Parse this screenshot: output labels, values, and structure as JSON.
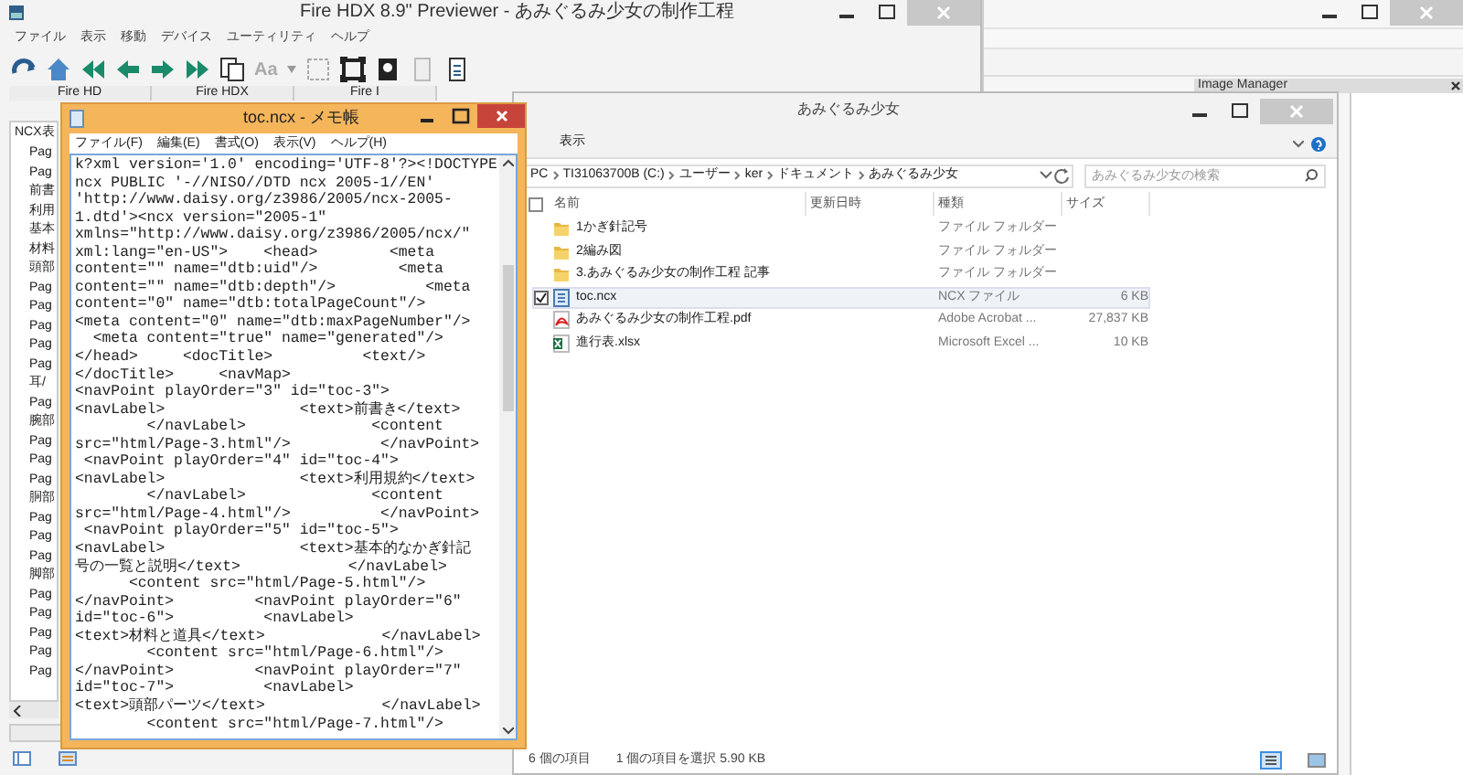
{
  "previewer": {
    "title": "Fire HDX 8.9\" Previewer - あみぐるみ少女の制作工程",
    "menu": [
      "ファイル",
      "表示",
      "移動",
      "デバイス",
      "ユーティリティ",
      "ヘルプ"
    ],
    "font_button": "Aa",
    "tabs": [
      {
        "label": "Fire HD",
        "selected": false
      },
      {
        "label": "Fire HDX",
        "selected": false
      },
      {
        "label": "Fire I",
        "selected": false
      }
    ],
    "panel_title": "NCX表",
    "ncx_items": [
      "Pag",
      "Pag",
      "前書",
      "利用",
      "基本",
      "材料",
      "頭部",
      "Pag",
      "Pag",
      "Pag",
      "Pag",
      "Pag",
      "耳/",
      "Pag",
      "腕部",
      "Pag",
      "Pag",
      "Pag",
      "胴部",
      "Pag",
      "Pag",
      "Pag",
      "脚部",
      "Pag",
      "Pag",
      "Pag",
      "Pag",
      "Pag"
    ]
  },
  "image_manager": {
    "title": "Image Manager"
  },
  "notepad": {
    "title": "toc.ncx - メモ帳",
    "menu": [
      "ファイル(F)",
      "編集(E)",
      "書式(O)",
      "表示(V)",
      "ヘルプ(H)"
    ],
    "lines": [
      "k?xml version='1.0' encoding='UTF-8'?><!DOCTYPE",
      "ncx PUBLIC '-//NISO//DTD ncx 2005-1//EN'",
      "'http://www.daisy.org/z3986/2005/ncx-2005-",
      "1.dtd'><ncx version=\"2005-1\"",
      "xmlns=\"http://www.daisy.org/z3986/2005/ncx/\"",
      "xml:lang=\"en-US\">    <head>        <meta",
      "content=\"\" name=\"dtb:uid\"/>         <meta",
      "content=\"\" name=\"dtb:depth\"/>          <meta",
      "content=\"0\" name=\"dtb:totalPageCount\"/>",
      "<meta content=\"0\" name=\"dtb:maxPageNumber\"/>",
      "  <meta content=\"true\" name=\"generated\"/>",
      "</head>     <docTitle>          <text/>",
      "</docTitle>     <navMap>",
      "<navPoint playOrder=\"3\" id=\"toc-3\">",
      "<navLabel>               <text>前書き</text>",
      "        </navLabel>              <content",
      "src=\"html/Page-3.html\"/>          </navPoint>",
      " <navPoint playOrder=\"4\" id=\"toc-4\">",
      "<navLabel>               <text>利用規約</text>",
      "        </navLabel>              <content",
      "src=\"html/Page-4.html\"/>          </navPoint>",
      " <navPoint playOrder=\"5\" id=\"toc-5\">",
      "<navLabel>               <text>基本的なかぎ針記",
      "号の一覧と説明</text>            </navLabel>",
      "      <content src=\"html/Page-5.html\"/>",
      "</navPoint>         <navPoint playOrder=\"6\"",
      "id=\"toc-6\">          <navLabel>",
      "<text>材料と道具</text>             </navLabel>",
      "        <content src=\"html/Page-6.html\"/>",
      "</navPoint>         <navPoint playOrder=\"7\"",
      "id=\"toc-7\">          <navLabel>",
      "<text>頭部パーツ</text>             </navLabel>",
      "        <content src=\"html/Page-7.html\"/>"
    ]
  },
  "explorer": {
    "title": "あみぐるみ少女",
    "ribbon_tab": "表示",
    "path": [
      "PC",
      "TI31063700B (C:)",
      "ユーザー",
      "ker",
      "ドキュメント",
      "あみぐるみ少女"
    ],
    "search": {
      "placeholder": "あみぐるみ少女の検索"
    },
    "columns": [
      "名前",
      "更新日時",
      "種類",
      "サイズ"
    ],
    "select_all": {
      "checked": false
    },
    "files": [
      {
        "kind": "folder",
        "name": "1かぎ針記号",
        "type": "ファイル フォルダー",
        "selected": false
      },
      {
        "kind": "folder",
        "name": "2編み図",
        "type": "ファイル フォルダー",
        "selected": false
      },
      {
        "kind": "folder",
        "name": "3.あみぐるみ少女の制作工程  記事",
        "type": "ファイル フォルダー",
        "selected": false
      },
      {
        "kind": "ncx",
        "name": "toc.ncx",
        "type": "NCX ファイル",
        "size": "6 KB",
        "selected": true
      },
      {
        "kind": "pdf",
        "name": "あみぐるみ少女の制作工程.pdf",
        "type": "Adobe Acrobat ...",
        "size": "27,837 KB",
        "selected": false
      },
      {
        "kind": "excel",
        "name": "進行表.xlsx",
        "type": "Microsoft Excel ...",
        "size": "10 KB",
        "selected": false
      }
    ],
    "status": [
      "6 個の項目",
      "1 個の項目を選択  5.90 KB"
    ]
  }
}
